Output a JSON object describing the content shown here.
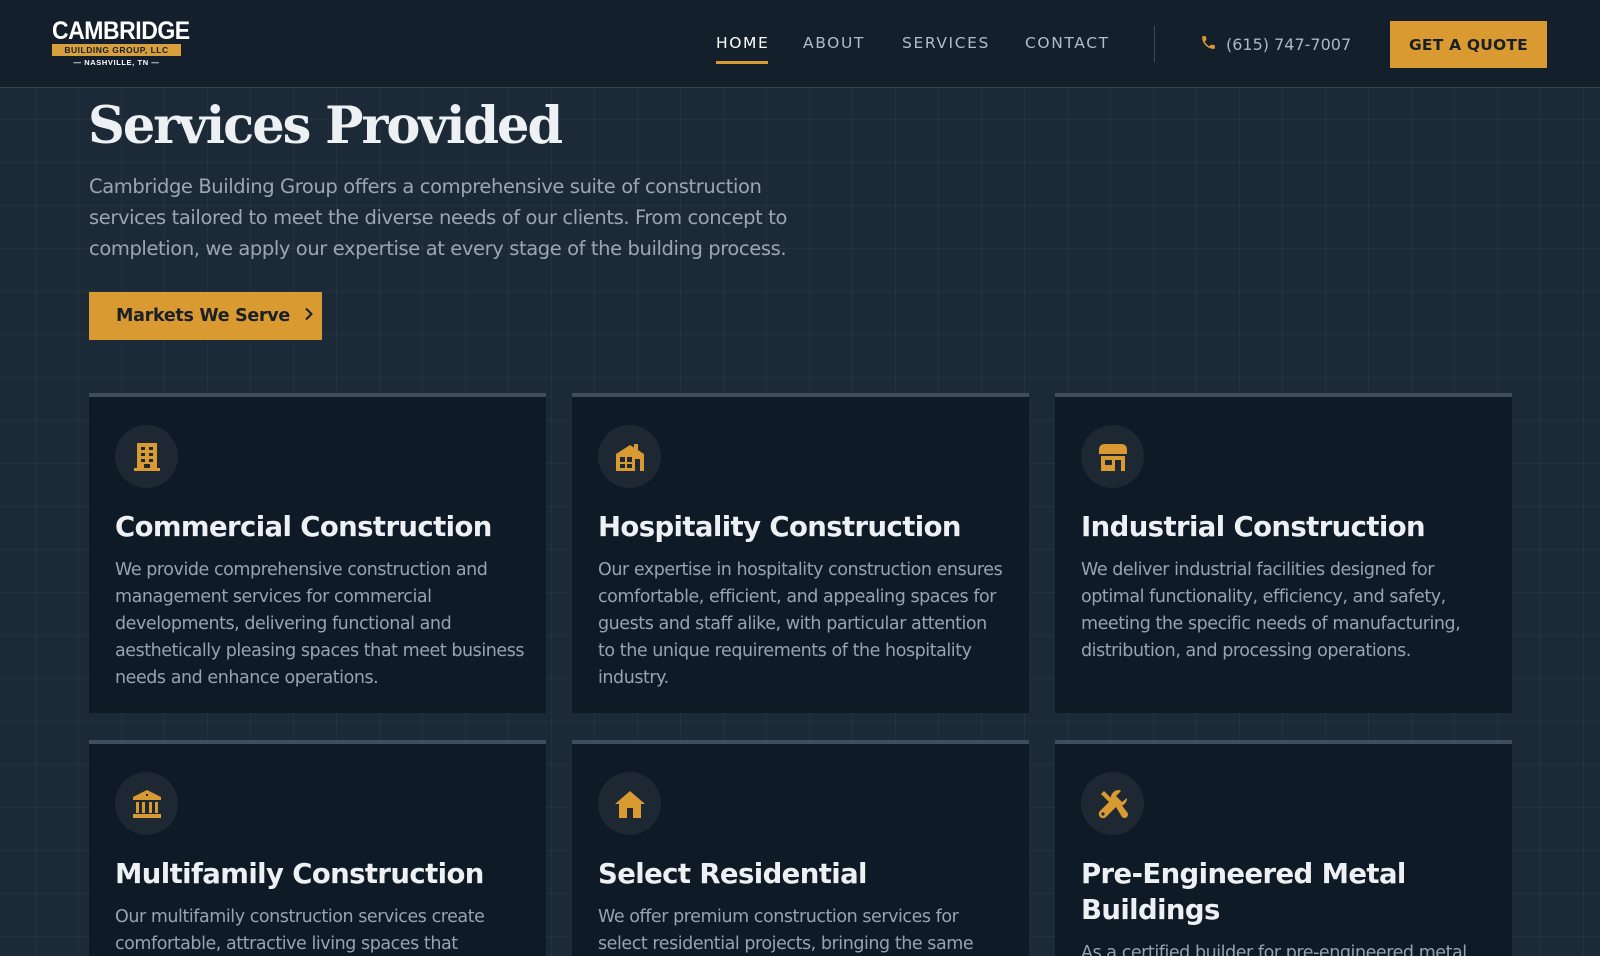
{
  "brand": {
    "name": "CAMBRIDGE",
    "subtitle": "BUILDING GROUP, LLC",
    "location": "— NASHVILLE, TN —"
  },
  "nav": {
    "links": [
      {
        "label": "HOME",
        "active": true
      },
      {
        "label": "ABOUT",
        "active": false
      },
      {
        "label": "SERVICES",
        "active": false
      },
      {
        "label": "CONTACT",
        "active": false
      }
    ],
    "phone": "(615) 747-7007",
    "cta": "GET A QUOTE"
  },
  "hero": {
    "title": "Services Provided",
    "description": "Cambridge Building Group offers a comprehensive suite of construction services tailored to meet the diverse needs of our clients. From concept to completion, we apply our expertise at every stage of the building process.",
    "button": "Markets We Serve"
  },
  "services": [
    {
      "icon": "office-building-icon",
      "title": "Commercial Construction",
      "text": "We provide comprehensive construction and management services for commercial developments, delivering functional and aesthetically pleasing spaces that meet business needs and enhance operations."
    },
    {
      "icon": "hotel-icon",
      "title": "Hospitality Construction",
      "text": "Our expertise in hospitality construction ensures comfortable, efficient, and appealing spaces for guests and staff alike, with particular attention to the unique requirements of the hospitality industry."
    },
    {
      "icon": "storefront-icon",
      "title": "Industrial Construction",
      "text": "We deliver industrial facilities designed for optimal functionality, efficiency, and safety, meeting the specific needs of manufacturing, distribution, and processing operations."
    },
    {
      "icon": "columned-building-icon",
      "title": "Multifamily Construction",
      "text": "Our multifamily construction services create comfortable, attractive living spaces that"
    },
    {
      "icon": "house-icon",
      "title": "Select Residential",
      "text": "We offer premium construction services for select residential projects, bringing the same"
    },
    {
      "icon": "tools-icon",
      "title": "Pre-Engineered Metal Buildings",
      "text": "As a certified builder for pre-engineered metal"
    }
  ],
  "colors": {
    "accent": "#d99a32",
    "background": "#1c2a38",
    "card": "#0e1a26",
    "nav": "#131f2b"
  }
}
